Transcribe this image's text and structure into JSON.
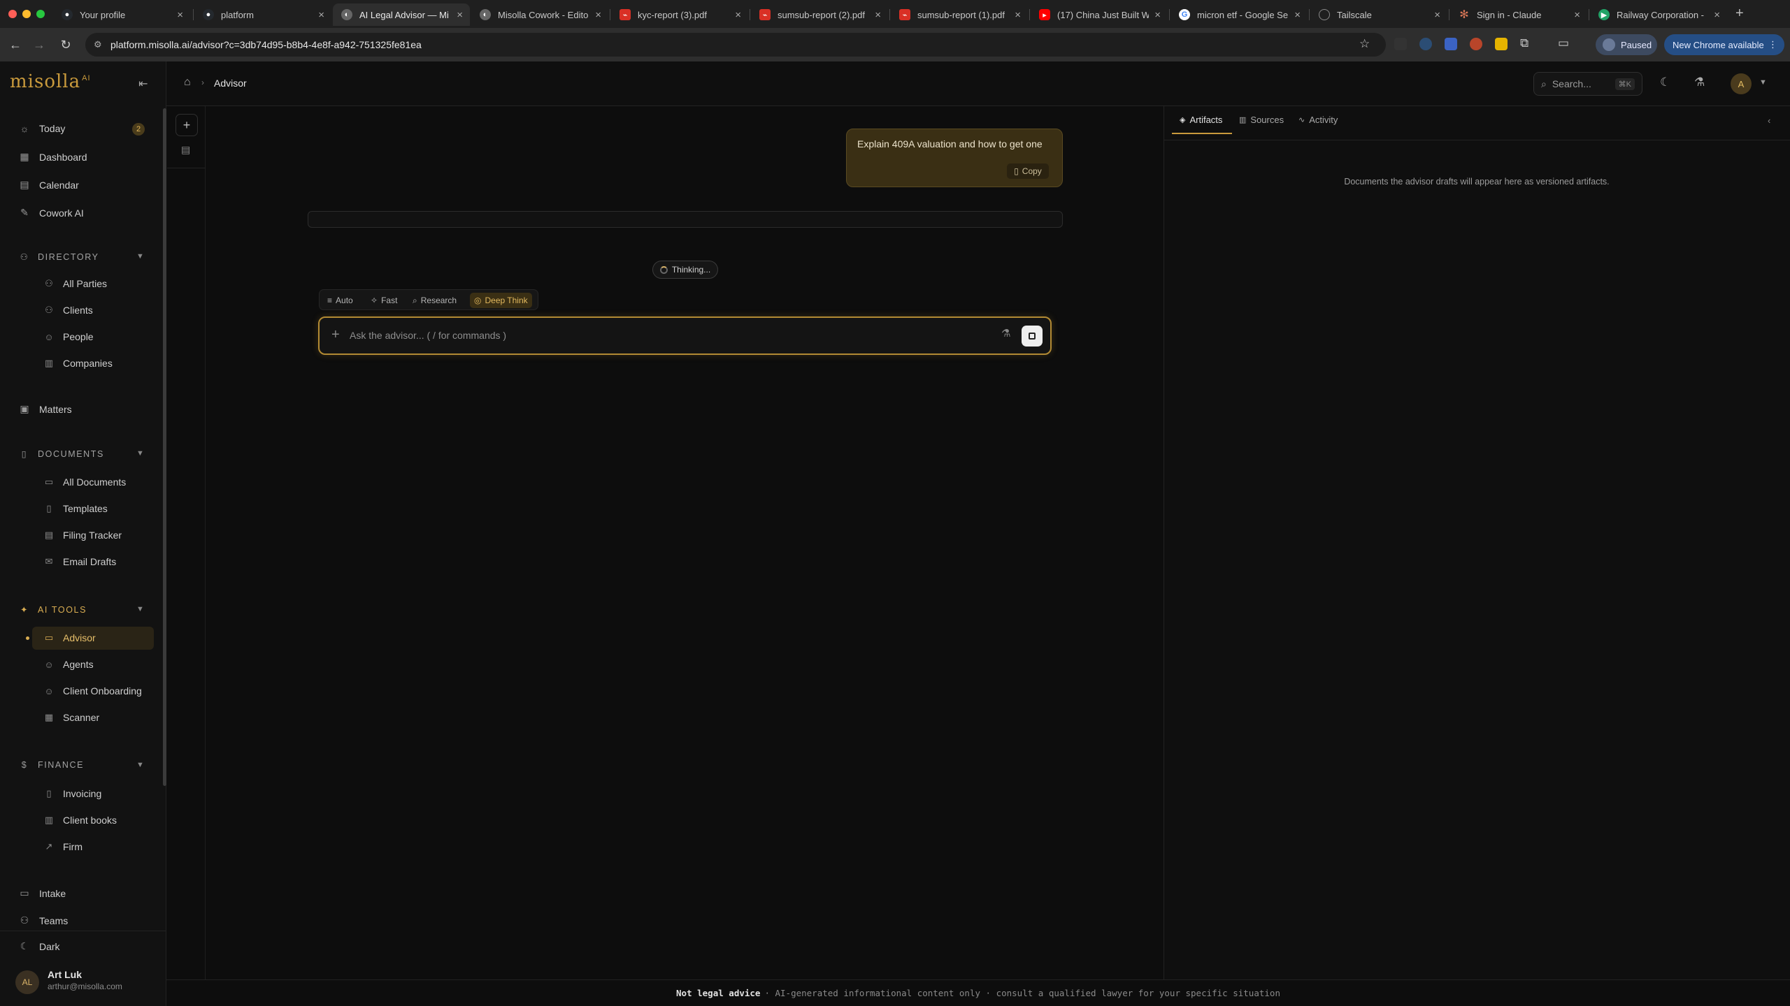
{
  "browser": {
    "tabs": [
      {
        "title": "Your profile",
        "icon": "github-icon",
        "color": "#24292e"
      },
      {
        "title": "platform",
        "icon": "github-icon",
        "color": "#24292e"
      },
      {
        "title": "AI Legal Advisor — Mi",
        "icon": "misolla-icon",
        "color": "#666666"
      },
      {
        "title": "Misolla Cowork - Edito",
        "icon": "misolla-icon",
        "color": "#666666"
      },
      {
        "title": "kyc-report (3).pdf",
        "icon": "pdf-icon",
        "color": "#d93025"
      },
      {
        "title": "sumsub-report (2).pdf",
        "icon": "pdf-icon",
        "color": "#d93025"
      },
      {
        "title": "sumsub-report (1).pdf",
        "icon": "pdf-icon",
        "color": "#d93025"
      },
      {
        "title": "(17) China Just Built W",
        "icon": "youtube-icon",
        "color": "#ff0000"
      },
      {
        "title": "micron etf - Google Se",
        "icon": "google-icon",
        "color": "#4285f4"
      },
      {
        "title": "Tailscale",
        "icon": "tailscale-icon",
        "color": "#555555"
      },
      {
        "title": "Sign in - Claude",
        "icon": "claude-icon",
        "color": "#d97757"
      },
      {
        "title": "Railway Corporation -",
        "icon": "railway-icon",
        "color": "#21a366"
      }
    ],
    "url": "platform.misolla.ai/advisor?c=3db74d95-b8b4-4e8f-a942-751325fe81ea",
    "paused_label": "Paused",
    "new_chrome_label": "New Chrome available"
  },
  "sidebar": {
    "logo": "misolla",
    "logo_sup": "AI",
    "top_items": [
      {
        "label": "Today",
        "icon": "sun-icon",
        "badge": "2"
      },
      {
        "label": "Dashboard",
        "icon": "grid-icon"
      },
      {
        "label": "Calendar",
        "icon": "calendar-icon"
      },
      {
        "label": "Cowork AI",
        "icon": "edit-icon"
      }
    ],
    "sections": {
      "directory": {
        "label": "DIRECTORY",
        "items": [
          "All Parties",
          "Clients",
          "People",
          "Companies"
        ]
      },
      "matters": {
        "label": "Matters"
      },
      "documents": {
        "label": "DOCUMENTS",
        "items": [
          "All Documents",
          "Templates",
          "Filing Tracker",
          "Email Drafts"
        ]
      },
      "ai_tools": {
        "label": "AI TOOLS",
        "items": [
          "Advisor",
          "Agents",
          "Client Onboarding",
          "Scanner"
        ]
      },
      "finance": {
        "label": "FINANCE",
        "items": [
          "Invoicing",
          "Client books",
          "Firm"
        ]
      },
      "intake": {
        "label": "Intake"
      },
      "teams": {
        "label": "Teams"
      }
    },
    "theme_label": "Dark",
    "user": {
      "initials": "AL",
      "name": "Art Luk",
      "email": "arthur@misolla.com"
    }
  },
  "header": {
    "breadcrumb": "Advisor",
    "search_placeholder": "Search...",
    "search_shortcut": "⌘K",
    "user_initial": "A"
  },
  "chat": {
    "user_message": "Explain 409A valuation and how to get one",
    "copy_label": "Copy",
    "status": "Thinking...",
    "modes": [
      {
        "label": "Auto",
        "active": false
      },
      {
        "label": "Fast",
        "active": false
      },
      {
        "label": "Research",
        "active": false
      },
      {
        "label": "Deep Think",
        "active": true
      }
    ],
    "input_placeholder": "Ask the advisor... ( / for commands )"
  },
  "right_panel": {
    "tabs": [
      "Artifacts",
      "Sources",
      "Activity"
    ],
    "active_tab": "Artifacts",
    "empty_text": "Documents the advisor drafts will appear here as versioned artifacts."
  },
  "footer": {
    "bold": "Not legal advice",
    "text": "· AI-generated informational content only · consult a qualified lawyer for your specific situation"
  }
}
